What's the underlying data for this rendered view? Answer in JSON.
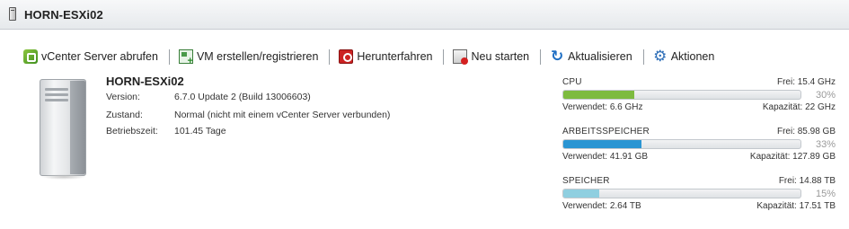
{
  "window": {
    "title": "HORN-ESXi02"
  },
  "toolbar": {
    "items": [
      {
        "label": "vCenter Server abrufen",
        "icon": "vcenter-icon"
      },
      {
        "label": "VM erstellen/registrieren",
        "icon": "vm-add-icon"
      },
      {
        "label": "Herunterfahren",
        "icon": "shutdown-icon"
      },
      {
        "label": "Neu starten",
        "icon": "restart-icon"
      },
      {
        "label": "Aktualisieren",
        "icon": "refresh-icon"
      },
      {
        "label": "Aktionen",
        "icon": "gear-icon"
      }
    ]
  },
  "host": {
    "name": "HORN-ESXi02",
    "rows": [
      {
        "label": "Version:",
        "value": "6.7.0 Update 2 (Build 13006603)"
      },
      {
        "label": "Zustand:",
        "value": "Normal (nicht mit einem vCenter Server verbunden)"
      },
      {
        "label": "Betriebszeit:",
        "value": "101.45 Tage"
      }
    ]
  },
  "resources": [
    {
      "name": "CPU",
      "free": "Frei: 15.4 GHz",
      "percent_label": "30%",
      "percent": 30,
      "used": "Verwendet: 6.6 GHz",
      "capacity": "Kapazität: 22 GHz",
      "color": "#7dbb3f"
    },
    {
      "name": "ARBEITSSPEICHER",
      "free": "Frei: 85.98 GB",
      "percent_label": "33%",
      "percent": 33,
      "used": "Verwendet: 41.91 GB",
      "capacity": "Kapazität: 127.89 GB",
      "color": "#2a95d3"
    },
    {
      "name": "SPEICHER",
      "free": "Frei: 14.88 TB",
      "percent_label": "15%",
      "percent": 15,
      "used": "Verwendet: 2.64 TB",
      "capacity": "Kapazität: 17.51 TB",
      "color": "#8fcfe0"
    }
  ]
}
